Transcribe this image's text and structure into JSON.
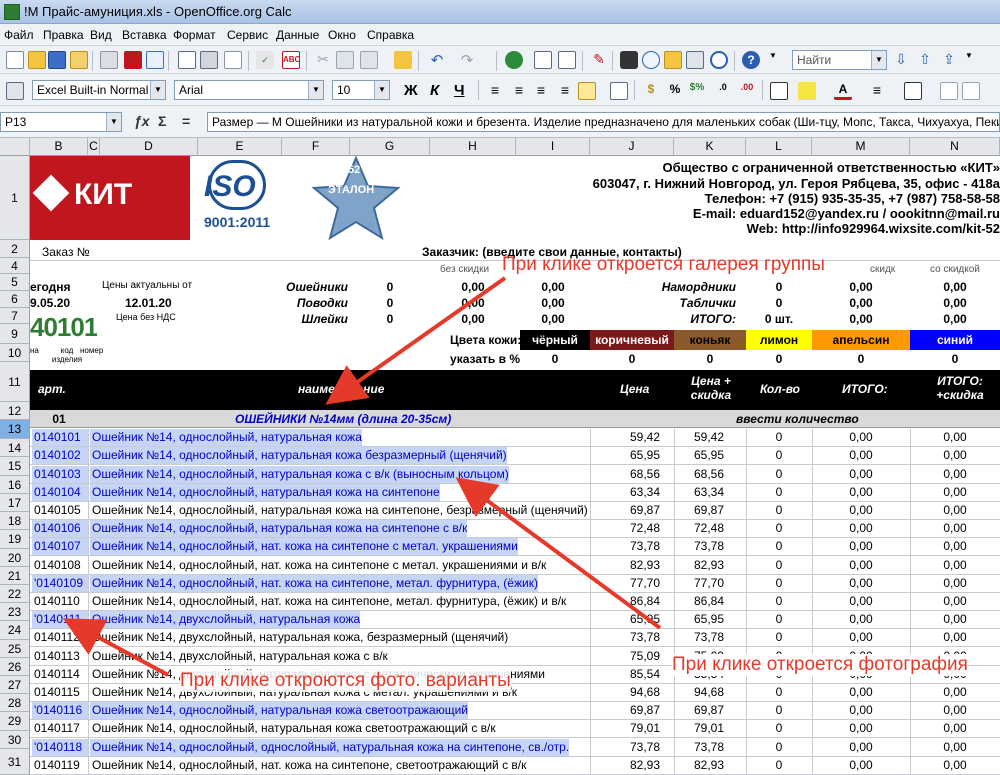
{
  "window": {
    "title": "!М Прайс-амуниция.xls - OpenOffice.org Calc"
  },
  "menu": [
    "Файл",
    "Правка",
    "Вид",
    "Вставка",
    "Формат",
    "Сервис",
    "Данные",
    "Окно",
    "Справка"
  ],
  "toolbar": {
    "find_placeholder": "Найти",
    "style_value": "Excel Built-in Normal",
    "font_value": "Arial",
    "size_value": "10",
    "bold": "Ж",
    "italic": "К",
    "underline": "Ч"
  },
  "formula_bar": {
    "cell_ref": "P13",
    "content": "Размер — М  Ошейники из натуральной кожи и брезента. Изделие предназначено для маленьких собак (Ши-тцу, Мопс, Такса, Чихуахуа, Пекинес, Ф"
  },
  "columns": [
    "B",
    "C",
    "D",
    "E",
    "F",
    "G",
    "H",
    "I",
    "J",
    "K",
    "L",
    "M",
    "N"
  ],
  "rows": [
    "1",
    "2",
    "4",
    "5",
    "6",
    "7",
    "9",
    "10",
    "11",
    "12",
    "13",
    "14",
    "15",
    "16",
    "17",
    "18",
    "19",
    "20",
    "21",
    "22",
    "23",
    "24",
    "25",
    "26",
    "27",
    "28",
    "29",
    "30",
    "31"
  ],
  "header": {
    "logo_text": "КИТ",
    "iso_text": "ISO",
    "iso_sub": "9001:2011",
    "etalon_text": "ЭТАЛОН",
    "etalon_num": "52",
    "company": "Общество с ограниченной ответственностью «КИТ»",
    "address": "603047, г. Нижний Новгород, ул. Героя Рябцева, 35, офис - 418а",
    "phone": "Телефон: +7 (915) 935-35-35, +7 (987) 758-58-58",
    "email": "E-mail: eduard152@yandex.ru / oookitnn@mail.ru",
    "web": "Web: http://info929964.wixsite.com/kit-52"
  },
  "order": {
    "order_label": "Заказ №",
    "customer_label": "Заказчик: (введите свои данные, контакты)",
    "no_discount": "без скидки",
    "discount_h": "скидк",
    "with_discount": "со скидкой",
    "today_label": "егодня",
    "today_value": "9.05.20",
    "prices_label": "Цены актуальны от",
    "prices_date": "12.01.20",
    "no_vat": "Цена без НДС",
    "code_digits": "40101",
    "code_cap1": "на",
    "code_cap2": "код изделия",
    "code_cap3": "номер",
    "summary": [
      {
        "label": "Ошейники",
        "qty": "0",
        "v1": "0,00",
        "v2": "0,00"
      },
      {
        "label": "Поводки",
        "qty": "0",
        "v1": "0,00",
        "v2": "0,00"
      },
      {
        "label": "Шлейки",
        "qty": "0",
        "v1": "0,00",
        "v2": "0,00"
      }
    ],
    "summary_right": [
      {
        "label": "Намордники",
        "qty": "0",
        "v1": "0,00",
        "v2": "0,00"
      },
      {
        "label": "Таблички",
        "qty": "0",
        "v1": "0,00",
        "v2": "0,00"
      },
      {
        "label": "ИТОГО:",
        "qty": "0 шт.",
        "v1": "0,00",
        "v2": "0,00"
      }
    ],
    "colors_label": "Цвета кожи:",
    "percent_label": "указать в %",
    "colors": [
      {
        "name": "чёрный",
        "bg": "#000000",
        "fg": "#ffffff",
        "pct": "0"
      },
      {
        "name": "коричневый",
        "bg": "#7a1a1a",
        "fg": "#ffffff",
        "pct": "0"
      },
      {
        "name": "коньяк",
        "bg": "#8b5a2b",
        "fg": "#000000",
        "pct": "0"
      },
      {
        "name": "лимон",
        "bg": "#ffff00",
        "fg": "#000000",
        "pct": "0"
      },
      {
        "name": "апельсин",
        "bg": "#ff9900",
        "fg": "#000000",
        "pct": "0"
      },
      {
        "name": "синий",
        "bg": "#0000ff",
        "fg": "#ffffff",
        "pct": "0"
      }
    ]
  },
  "table_header": {
    "art": "арт.",
    "name": "наименование",
    "price": "Цена",
    "price_disc": "Цена + скидка",
    "qty": "Кол-во",
    "total": "ИТОГО:",
    "total_disc": "ИТОГО: +скидка"
  },
  "group": {
    "code": "01",
    "title": "ОШЕЙНИКИ №14мм (длина 20-35см)",
    "enter_qty": "ввести количество"
  },
  "items": [
    {
      "art": "0140101",
      "name": "Ошейник №14, однослойный, натуральная кожа",
      "price": "59,42",
      "pdisc": "59,42",
      "qty": "0",
      "t1": "0,00",
      "t2": "0,00",
      "hl": true
    },
    {
      "art": "0140102",
      "name": "Ошейник №14, однослойный, натуральная кожа безразмерный (щенячий)",
      "price": "65,95",
      "pdisc": "65,95",
      "qty": "0",
      "t1": "0,00",
      "t2": "0,00",
      "hl": true
    },
    {
      "art": "0140103",
      "name": "Ошейник №14, однослойный, натуральная кожа с в/к (выносным кольцом)",
      "price": "68,56",
      "pdisc": "68,56",
      "qty": "0",
      "t1": "0,00",
      "t2": "0,00",
      "hl": true
    },
    {
      "art": "0140104",
      "name": "Ошейник №14, однослойный, натуральная кожа на синтепоне",
      "price": "63,34",
      "pdisc": "63,34",
      "qty": "0",
      "t1": "0,00",
      "t2": "0,00",
      "hl": true
    },
    {
      "art": "0140105",
      "name": "Ошейник №14, однослойный, натуральная кожа на синтепоне, безразмерный (щенячий)",
      "price": "69,87",
      "pdisc": "69,87",
      "qty": "0",
      "t1": "0,00",
      "t2": "0,00",
      "hl": false
    },
    {
      "art": "0140106",
      "name": "Ошейник №14, однослойный, натуральная кожа на синтепоне с в/к",
      "price": "72,48",
      "pdisc": "72,48",
      "qty": "0",
      "t1": "0,00",
      "t2": "0,00",
      "hl": true
    },
    {
      "art": "0140107",
      "name": "Ошейник №14, однослойный, нат. кожа на синтепоне с метал. украшениями",
      "price": "73,78",
      "pdisc": "73,78",
      "qty": "0",
      "t1": "0,00",
      "t2": "0,00",
      "hl": true
    },
    {
      "art": "0140108",
      "name": "Ошейник №14, однослойный, нат. кожа на синтепоне с метал. украшениями и в/к",
      "price": "82,93",
      "pdisc": "82,93",
      "qty": "0",
      "t1": "0,00",
      "t2": "0,00",
      "hl": false
    },
    {
      "art": "'0140109",
      "name": "Ошейник №14, однослойный, нат. кожа на синтепоне, метал. фурнитура, (ёжик)",
      "price": "77,70",
      "pdisc": "77,70",
      "qty": "0",
      "t1": "0,00",
      "t2": "0,00",
      "hl": true
    },
    {
      "art": "0140110",
      "name": "Ошейник №14, однослойный, нат. кожа на синтепоне, метал. фурнитура, (ёжик) и в/к",
      "price": "86,84",
      "pdisc": "86,84",
      "qty": "0",
      "t1": "0,00",
      "t2": "0,00",
      "hl": false
    },
    {
      "art": "'0140111",
      "name": "Ошейник №14, двухслойный, натуральная кожа",
      "price": "65,95",
      "pdisc": "65,95",
      "qty": "0",
      "t1": "0,00",
      "t2": "0,00",
      "hl": true
    },
    {
      "art": "0140112",
      "name": "Ошейник №14, двухслойный, натуральная кожа, безразмерный (щенячий)",
      "price": "73,78",
      "pdisc": "73,78",
      "qty": "0",
      "t1": "0,00",
      "t2": "0,00",
      "hl": false
    },
    {
      "art": "0140113",
      "name": "Ошейник №14, двухслойный, натуральная кожа с в/к",
      "price": "75,09",
      "pdisc": "75,09",
      "qty": "0",
      "t1": "0,00",
      "t2": "0,00",
      "hl": false
    },
    {
      "art": "0140114",
      "name": "Ошейник №14, двухслойный, натуральная кожа с металлическими украшениями",
      "price": "85,54",
      "pdisc": "85,54",
      "qty": "0",
      "t1": "0,00",
      "t2": "0,00",
      "hl": false
    },
    {
      "art": "0140115",
      "name": "Ошейник №14, двухслойный, натуральная кожа с метал. украшениями и в/к",
      "price": "94,68",
      "pdisc": "94,68",
      "qty": "0",
      "t1": "0,00",
      "t2": "0,00",
      "hl": false
    },
    {
      "art": "'0140116",
      "name": "Ошейник №14, однослойный, натуральная кожа светоотражающий",
      "price": "69,87",
      "pdisc": "69,87",
      "qty": "0",
      "t1": "0,00",
      "t2": "0,00",
      "hl": true
    },
    {
      "art": "0140117",
      "name": "Ошейник №14, однослойный, натуральная кожа светоотражающий с в/к",
      "price": "79,01",
      "pdisc": "79,01",
      "qty": "0",
      "t1": "0,00",
      "t2": "0,00",
      "hl": false
    },
    {
      "art": "'0140118",
      "name": "Ошейник №14, однослойный, однослойный, натуральная кожа на синтепоне, св./отр.",
      "price": "73,78",
      "pdisc": "73,78",
      "qty": "0",
      "t1": "0,00",
      "t2": "0,00",
      "hl": true
    },
    {
      "art": "0140119",
      "name": "Ошейник №14, однослойный, нат. кожа на синтепоне, светоотражающий с в/к",
      "price": "82,93",
      "pdisc": "82,93",
      "qty": "0",
      "t1": "0,00",
      "t2": "0,00",
      "hl": false
    }
  ],
  "annotations": {
    "gallery": "При клике откроется галерея группы",
    "photo": "При клике откроется фотография",
    "variants": "При клике откроются фото. варианты"
  },
  "colors": {
    "accent_red": "#e53a2a",
    "highlight": "#c6d4f5",
    "link": "#0000cc",
    "brand_red": "#c0161d"
  }
}
